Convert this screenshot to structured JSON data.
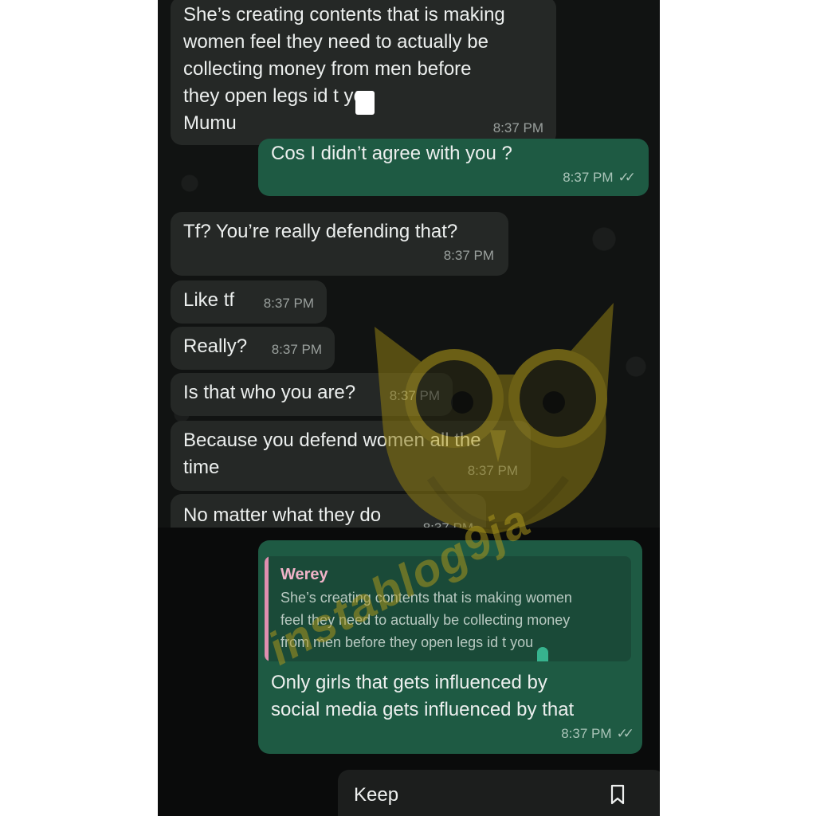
{
  "messages": [
    {
      "id": "m1",
      "direction": "incoming",
      "text": "She’s creating contents that is making\nwomen feel they need to actually be\ncollecting money from men before\nthey open legs id  t you\nMumu",
      "time": "8:37 PM"
    },
    {
      "id": "m2",
      "direction": "outgoing",
      "text": "Cos I didn’t agree with you ?",
      "time": "8:37 PM",
      "status": "read"
    },
    {
      "id": "m3",
      "direction": "incoming",
      "text": "Tf? You’re really defending that?",
      "time": "8:37 PM"
    },
    {
      "id": "m4",
      "direction": "incoming",
      "text": "Like tf",
      "time": "8:37 PM"
    },
    {
      "id": "m5",
      "direction": "incoming",
      "text": "Really?",
      "time": "8:37 PM"
    },
    {
      "id": "m6",
      "direction": "incoming",
      "text": "Is that who you are?",
      "time": "8:37 PM"
    },
    {
      "id": "m7",
      "direction": "incoming",
      "text": "Because you defend women all the\ntime",
      "time": "8:37 PM"
    },
    {
      "id": "m8",
      "direction": "incoming",
      "text": "No matter what they do",
      "time": "8:37 PM"
    },
    {
      "id": "m9",
      "direction": "outgoing",
      "reply_to": {
        "sender": "Werey",
        "text": "She’s creating contents that is making women\nfeel they need to actually be collecting money\nfrom men before they open legs id  t you"
      },
      "text": "Only girls that gets influenced by\nsocial media gets influenced by that",
      "time": "8:37 PM",
      "status": "read"
    }
  ],
  "bottom_bar": {
    "keep_label": "Keep",
    "icon": "bookmark-icon"
  },
  "watermark": {
    "text": "instablog9ja"
  },
  "colors": {
    "incoming_bubble": "#252826",
    "outgoing_bubble": "#1e5a43",
    "reply_name": "#f0b3c8",
    "reply_bar": "#e08fb0",
    "background": "#111312"
  },
  "icons": {
    "read_receipt": "double-check-icon"
  }
}
